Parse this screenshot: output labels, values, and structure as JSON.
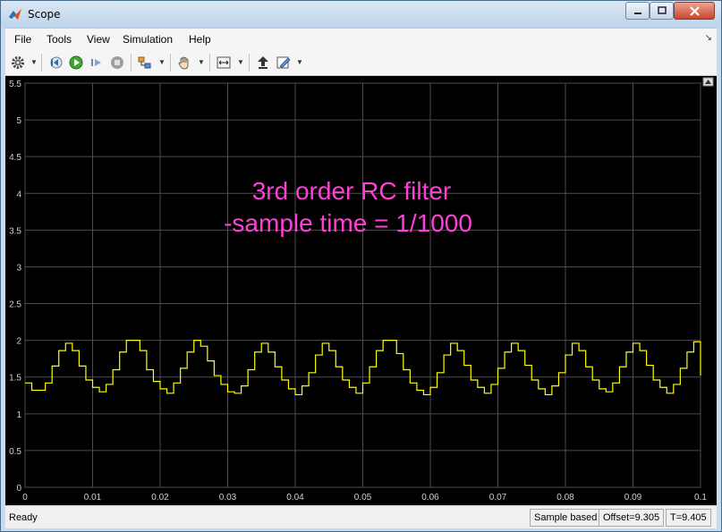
{
  "window": {
    "title": "Scope"
  },
  "menu": [
    "File",
    "Tools",
    "View",
    "Simulation",
    "Help"
  ],
  "toolbar_icons": [
    "gear-icon",
    "step-back-icon",
    "run-icon",
    "step-forward-icon",
    "stop-icon",
    "highlight-block-icon",
    "pan-icon",
    "zoom-fit-icon",
    "restore-icon",
    "style-icon"
  ],
  "plot": {
    "annotation_line1": "3rd order RC filter",
    "annotation_line2": "-sample time = 1/1000",
    "annotation_color": "#ff3fd6",
    "line_color": "#ffff00",
    "background": "#000000",
    "grid_color": "#4d4d4d"
  },
  "chart_data": {
    "type": "line",
    "step": true,
    "xlim": [
      0,
      0.1
    ],
    "ylim": [
      0,
      5.5
    ],
    "xticks": [
      "0",
      "0.01",
      "0.02",
      "0.03",
      "0.04",
      "0.05",
      "0.06",
      "0.07",
      "0.08",
      "0.09",
      "0.1"
    ],
    "yticks": [
      "0",
      "0.5",
      "1",
      "1.5",
      "2",
      "2.5",
      "3",
      "3.5",
      "4",
      "4.5",
      "5",
      "5.5"
    ],
    "grid": true,
    "sample_time": 0.001,
    "series": [
      {
        "color": "#ffff00",
        "y": [
          1.42,
          1.32,
          1.32,
          1.42,
          1.65,
          1.86,
          1.96,
          1.86,
          1.65,
          1.46,
          1.36,
          1.3,
          1.4,
          1.6,
          1.84,
          2.0,
          2.0,
          1.86,
          1.6,
          1.44,
          1.34,
          1.28,
          1.42,
          1.62,
          1.84,
          2.0,
          1.92,
          1.72,
          1.52,
          1.4,
          1.3,
          1.28,
          1.38,
          1.6,
          1.84,
          1.96,
          1.84,
          1.64,
          1.46,
          1.34,
          1.26,
          1.38,
          1.56,
          1.8,
          1.96,
          1.86,
          1.64,
          1.46,
          1.36,
          1.28,
          1.42,
          1.64,
          1.86,
          2.0,
          2.0,
          1.82,
          1.6,
          1.42,
          1.32,
          1.26,
          1.36,
          1.56,
          1.8,
          1.96,
          1.86,
          1.66,
          1.46,
          1.36,
          1.28,
          1.4,
          1.62,
          1.84,
          1.96,
          1.86,
          1.66,
          1.46,
          1.34,
          1.26,
          1.38,
          1.56,
          1.8,
          1.96,
          1.86,
          1.64,
          1.46,
          1.34,
          1.3,
          1.42,
          1.64,
          1.84,
          1.96,
          1.86,
          1.66,
          1.46,
          1.36,
          1.28,
          1.4,
          1.62,
          1.84,
          1.98,
          1.86,
          1.66,
          1.52
        ]
      }
    ]
  },
  "status": {
    "ready": "Ready",
    "mode": "Sample based",
    "offset": "Offset=9.305",
    "time": "T=9.405"
  }
}
